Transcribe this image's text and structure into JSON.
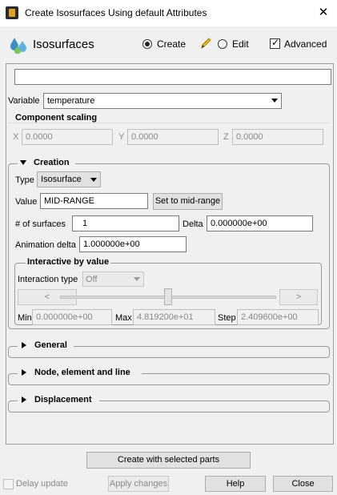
{
  "window": {
    "title": "Create Isosurfaces Using default Attributes"
  },
  "header": {
    "title": "Isosurfaces",
    "mode_create": "Create",
    "mode_edit": "Edit",
    "advanced_label": "Advanced",
    "advanced_checked": true,
    "mode_selected": "Create"
  },
  "search": {
    "value": ""
  },
  "variable": {
    "label": "Variable",
    "value": "temperature"
  },
  "component_scaling": {
    "title": "Component scaling",
    "x_label": "X",
    "x_value": "0.0000",
    "y_label": "Y",
    "y_value": "0.0000",
    "z_label": "Z",
    "z_value": "0.0000"
  },
  "creation": {
    "title": "Creation",
    "type_label": "Type",
    "type_value": "Isosurface",
    "value_label": "Value",
    "value_value": "MID-RANGE",
    "set_mid_button": "Set to mid-range",
    "num_surfaces_label": "# of surfaces",
    "num_surfaces_value": "1",
    "delta_label": "Delta",
    "delta_value": "0.000000e+00",
    "anim_delta_label": "Animation delta",
    "anim_delta_value": "1.000000e+00",
    "interactive": {
      "title": "Interactive by value",
      "interaction_type_label": "Interaction type",
      "interaction_type_value": "Off",
      "prev_button": "<",
      "next_button": ">",
      "slider_position": 0.5,
      "min_label": "Min",
      "min_value": "0.000000e+00",
      "max_label": "Max",
      "max_value": "4.819200e+01",
      "step_label": "Step",
      "step_value": "2.409600e+00"
    }
  },
  "sections": {
    "general": "General",
    "node_element_line": "Node, element and line",
    "displacement": "Displacement"
  },
  "footer": {
    "create_button": "Create with selected parts",
    "delay_update_label": "Delay update",
    "apply_button": "Apply changes",
    "help_button": "Help",
    "close_button": "Close"
  }
}
